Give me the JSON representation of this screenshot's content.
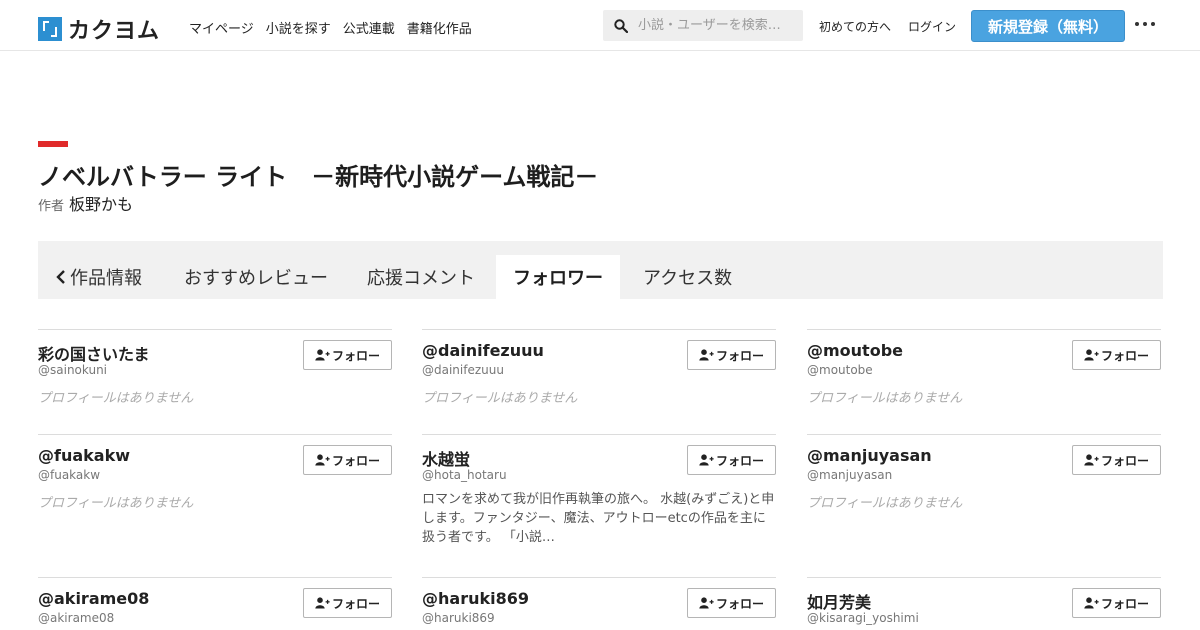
{
  "header": {
    "logo_text": "カクヨム",
    "nav": [
      "マイページ",
      "小説を探す",
      "公式連載",
      "書籍化作品"
    ],
    "search_placeholder": "小説・ユーザーを検索…",
    "first_time": "初めての方へ",
    "login": "ログイン",
    "signup": "新規登録（無料）"
  },
  "work": {
    "title": "ノベルバトラー ライト　－新時代小説ゲーム戦記－",
    "author_label": "作者",
    "author_name": "板野かも"
  },
  "tabs": [
    "作品情報",
    "おすすめレビュー",
    "応援コメント",
    "フォロワー",
    "アクセス数"
  ],
  "active_tab": "フォロワー",
  "follow_label": "フォロー",
  "followers": [
    {
      "name": "彩の国さいたま",
      "handle": "@sainokuni",
      "profile": "プロフィールはありません",
      "has_profile": false
    },
    {
      "name": "@dainifezuuu",
      "handle": "@dainifezuuu",
      "profile": "プロフィールはありません",
      "has_profile": false
    },
    {
      "name": "@moutobe",
      "handle": "@moutobe",
      "profile": "プロフィールはありません",
      "has_profile": false
    },
    {
      "name": "@fuakakw",
      "handle": "@fuakakw",
      "profile": "プロフィールはありません",
      "has_profile": false
    },
    {
      "name": "水越蛍",
      "handle": "@hota_hotaru",
      "profile": "ロマンを求めて我が旧作再執筆の旅へ。 水越(みずごえ)と申します。ファンタジー、魔法、アウトローetcの作品を主に扱う者です。 「小説…",
      "has_profile": true
    },
    {
      "name": "@manjuyasan",
      "handle": "@manjuyasan",
      "profile": "プロフィールはありません",
      "has_profile": false
    },
    {
      "name": "@akirame08",
      "handle": "@akirame08",
      "profile": "",
      "has_profile": false
    },
    {
      "name": "@haruki869",
      "handle": "@haruki869",
      "profile": "",
      "has_profile": false
    },
    {
      "name": "如月芳美",
      "handle": "@kisaragi_yoshimi",
      "profile": "",
      "has_profile": false
    }
  ]
}
